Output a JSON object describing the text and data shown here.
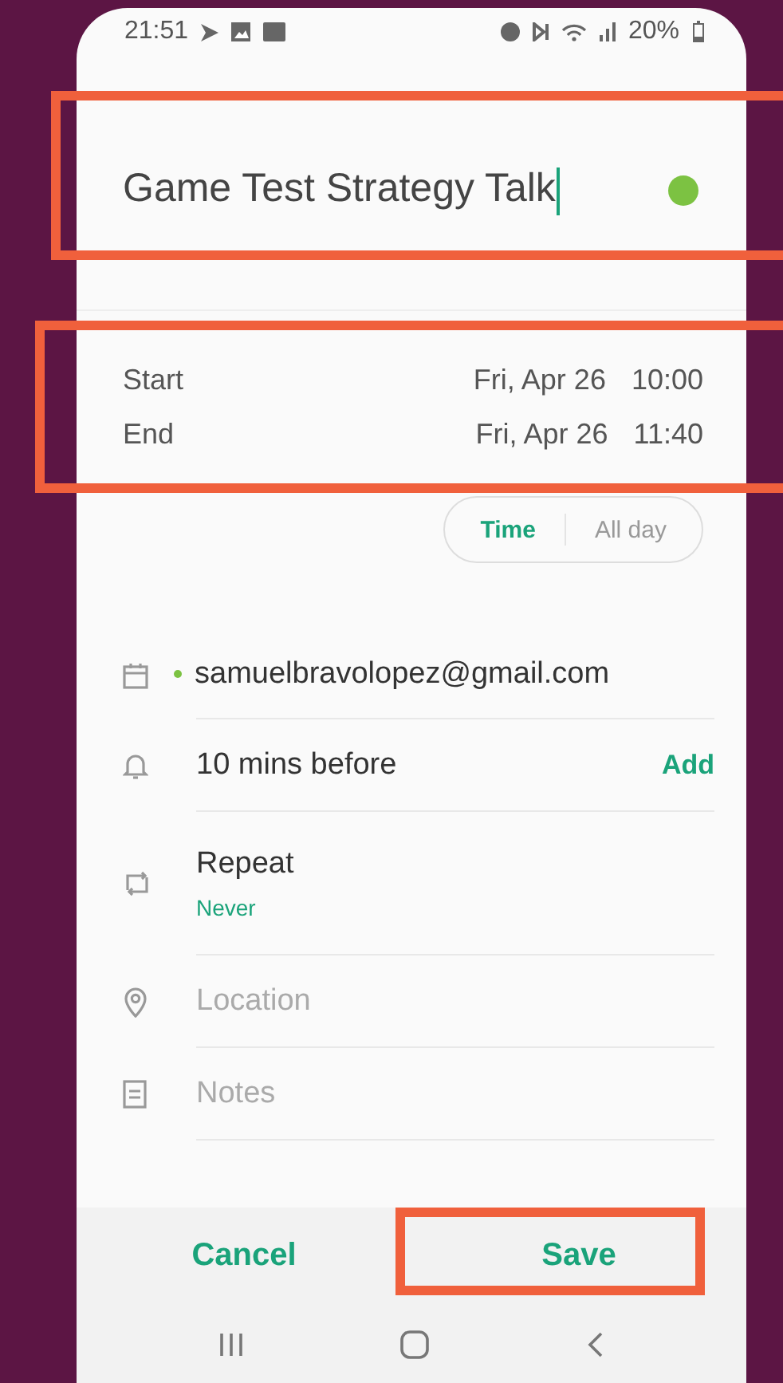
{
  "status_bar": {
    "time": "21:51",
    "battery": "20%"
  },
  "title": {
    "text": "Game Test Strategy Talk",
    "color": "#7cc242"
  },
  "times": [
    {
      "label": "Start",
      "date": "Fri, Apr 26",
      "time": "10:00"
    },
    {
      "label": "End",
      "date": "Fri, Apr 26",
      "time": "11:40"
    }
  ],
  "mode_toggle": [
    {
      "label": "Time",
      "selected": true
    },
    {
      "label": "All day",
      "selected": false
    }
  ],
  "calendar": {
    "account": "samuelbravolopez@gmail.com",
    "color": "#7cc242"
  },
  "rows": [
    {
      "kind": "value",
      "text": "10 mins before",
      "action": "Add"
    },
    {
      "kind": "sub",
      "text": "Repeat",
      "sub": "Never"
    },
    {
      "kind": "placeholder",
      "placeholder": "Location"
    },
    {
      "kind": "placeholder",
      "placeholder": "Notes"
    }
  ],
  "buttons": [
    {
      "label": "Cancel"
    },
    {
      "label": "Save"
    }
  ]
}
